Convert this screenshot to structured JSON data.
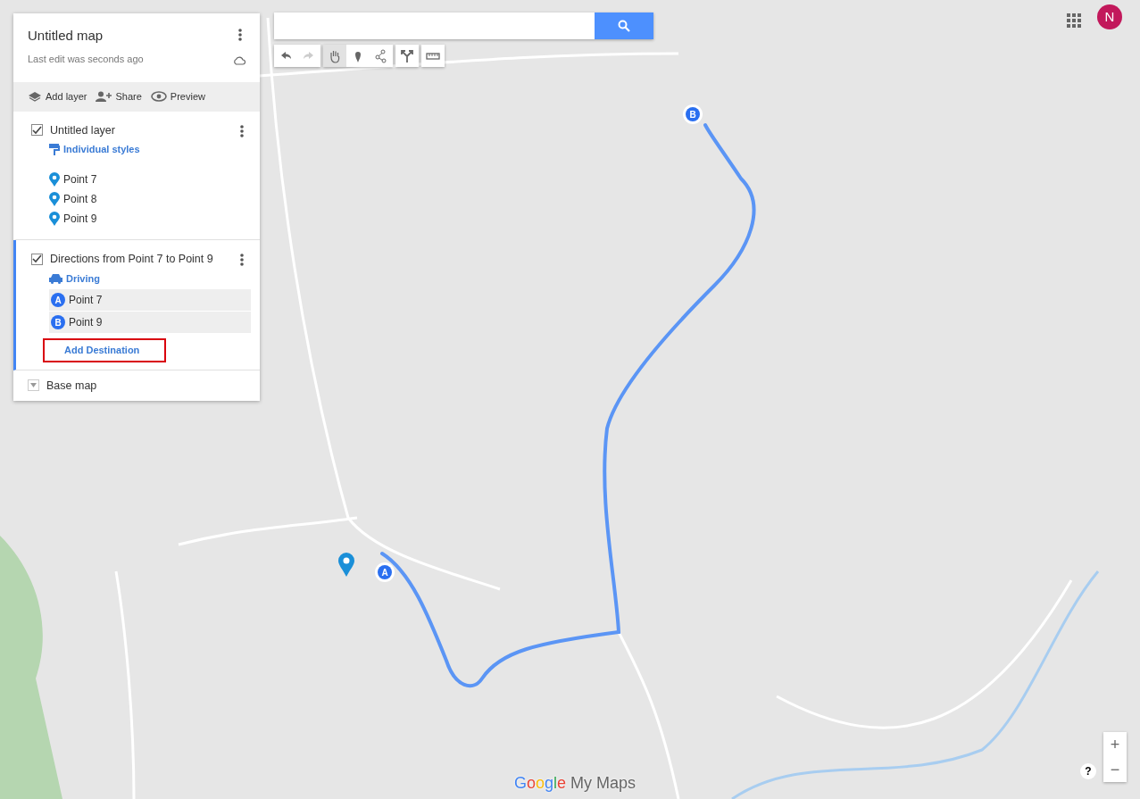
{
  "map_title": "Untitled map",
  "last_edit": "Last edit was seconds ago",
  "actions": [
    {
      "kind": "layers",
      "label": "Add layer"
    },
    {
      "kind": "share",
      "label": "Share"
    },
    {
      "kind": "preview",
      "label": "Preview"
    }
  ],
  "layers": [
    {
      "kind": "points",
      "title": "Untitled layer",
      "checked": true,
      "active": false,
      "style_label": "Individual styles",
      "items": [
        {
          "label": "Point 7"
        },
        {
          "label": "Point 8"
        },
        {
          "label": "Point 9"
        }
      ]
    },
    {
      "kind": "directions",
      "title": "Directions from Point 7 to Point 9",
      "checked": true,
      "active": true,
      "mode_label": "Driving",
      "stops": [
        {
          "marker": "A",
          "label": "Point 7"
        },
        {
          "marker": "B",
          "label": "Point 9"
        }
      ],
      "add_destination": {
        "label": "Add Destination",
        "highlighted": true
      }
    }
  ],
  "base_map": {
    "label": "Base map",
    "expanded": false
  },
  "tools": [
    {
      "kind": "undo",
      "selected": false,
      "disabled": false
    },
    {
      "kind": "redo",
      "selected": false,
      "disabled": true
    },
    {
      "kind": "hand",
      "selected": true,
      "disabled": false
    },
    {
      "kind": "marker",
      "selected": false,
      "disabled": false
    },
    {
      "kind": "line",
      "selected": false,
      "disabled": false
    },
    {
      "kind": "directions",
      "selected": false,
      "disabled": false
    },
    {
      "kind": "ruler",
      "selected": false,
      "disabled": false
    }
  ],
  "account": {
    "initial": "N"
  },
  "route_markers": [
    {
      "label": "A"
    },
    {
      "label": "B"
    }
  ],
  "logo": {
    "brand": "Google",
    "product": "My Maps"
  },
  "zoom_controls": [
    "+",
    "−"
  ],
  "help": "?"
}
